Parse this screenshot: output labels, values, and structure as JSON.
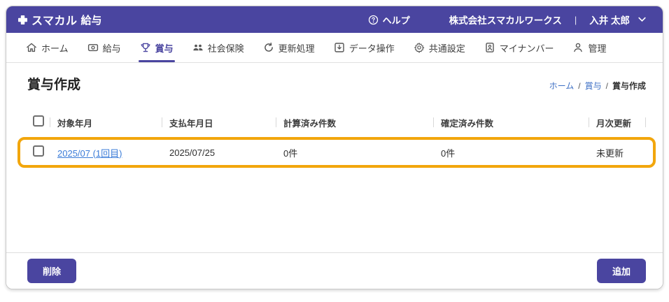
{
  "app": {
    "logo_brand": "スマカル",
    "logo_suffix": "給与",
    "help_label": "ヘルプ",
    "company_name": "株式会社スマカルワークス",
    "divider": "|",
    "user_name": "入井 太郎"
  },
  "nav": {
    "items": [
      {
        "label": "ホーム",
        "icon": "home-icon",
        "active": false
      },
      {
        "label": "給与",
        "icon": "banknote-icon",
        "active": false
      },
      {
        "label": "賞与",
        "icon": "trophy-icon",
        "active": true
      },
      {
        "label": "社会保険",
        "icon": "people-icon",
        "active": false
      },
      {
        "label": "更新処理",
        "icon": "refresh-icon",
        "active": false
      },
      {
        "label": "データ操作",
        "icon": "download-box-icon",
        "active": false
      },
      {
        "label": "共通設定",
        "icon": "gear-icon",
        "active": false
      },
      {
        "label": "マイナンバー",
        "icon": "id-card-icon",
        "active": false
      },
      {
        "label": "管理",
        "icon": "person-icon",
        "active": false
      }
    ]
  },
  "page": {
    "title": "賞与作成",
    "breadcrumb": {
      "home": "ホーム",
      "section": "賞与",
      "current": "賞与作成",
      "separator": "/"
    }
  },
  "table": {
    "headers": {
      "target_month": "対象年月",
      "payment_date": "支払年月日",
      "calculated_count": "計算済み件数",
      "confirmed_count": "確定済み件数",
      "monthly_update": "月次更新"
    },
    "rows": [
      {
        "target_month": "2025/07 (1回目)",
        "payment_date": "2025/07/25",
        "calculated_count": "0件",
        "confirmed_count": "0件",
        "monthly_update": "未更新",
        "checked": false,
        "highlighted": true
      }
    ]
  },
  "footer": {
    "delete_label": "削除",
    "add_label": "追加"
  },
  "colors": {
    "primary_purple": "#4a45a0",
    "highlight_orange": "#f2a60c",
    "row_link_blue": "#3b7cd8",
    "breadcrumb_link_blue": "#3d6fc4"
  }
}
